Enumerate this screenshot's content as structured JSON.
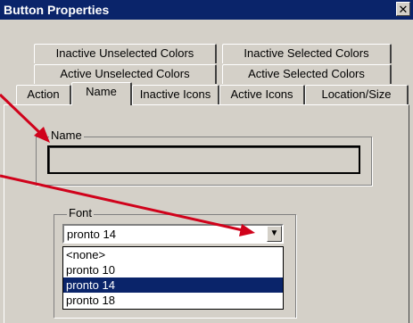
{
  "window": {
    "title": "Button Properties",
    "close_glyph": "✕"
  },
  "tabs": {
    "row1": [
      "Inactive Unselected Colors",
      "Inactive Selected Colors"
    ],
    "row2": [
      "Active Unselected Colors",
      "Active Selected Colors"
    ],
    "row3": [
      "Action",
      "Name",
      "Inactive Icons",
      "Active Icons",
      "Location/Size"
    ],
    "active": "Name"
  },
  "name_group": {
    "legend": "Name",
    "value": ""
  },
  "font_group": {
    "legend": "Font",
    "selected": "pronto 14",
    "dropdown_arrow": "▼",
    "options": [
      "<none>",
      "pronto 10",
      "pronto 14",
      "pronto 18"
    ]
  },
  "colors": {
    "titlebar": "#0a246a",
    "arrow": "#d0021b",
    "selection": "#0a246a"
  }
}
